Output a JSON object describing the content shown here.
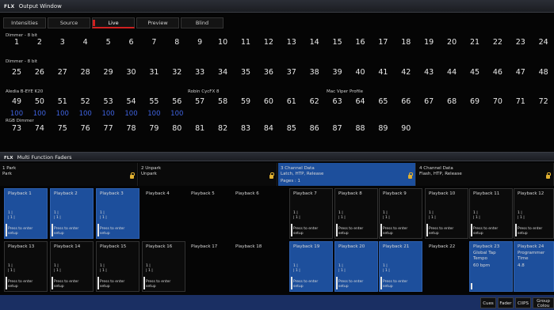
{
  "output_window": {
    "brand": "FLX",
    "title": "Output Window",
    "tabs": [
      {
        "label": "Intensities"
      },
      {
        "label": "Source"
      },
      {
        "label": "Live"
      },
      {
        "label": "Preview"
      },
      {
        "label": "Blind"
      }
    ],
    "fixture_labels": [
      "Dimmer - 8 bit",
      "Dimmer - 8 bit",
      "Aledia B-EYE K20",
      "Robin CycFX 8",
      "Mac Viper Profile",
      "RGB Dimmer"
    ],
    "rows": [
      [
        "1",
        "2",
        "3",
        "4",
        "5",
        "6",
        "7",
        "8",
        "9",
        "10",
        "11",
        "12",
        "13",
        "14",
        "15",
        "16",
        "17",
        "18",
        "19",
        "20",
        "21",
        "22",
        "23",
        "24"
      ],
      [
        "25",
        "26",
        "27",
        "28",
        "29",
        "30",
        "31",
        "32",
        "33",
        "34",
        "35",
        "36",
        "37",
        "38",
        "39",
        "40",
        "41",
        "42",
        "43",
        "44",
        "45",
        "46",
        "47",
        "48"
      ],
      [
        "49",
        "50",
        "51",
        "52",
        "53",
        "54",
        "55",
        "56",
        "57",
        "58",
        "59",
        "60",
        "61",
        "62",
        "63",
        "64",
        "65",
        "66",
        "67",
        "68",
        "69",
        "70",
        "71",
        "72"
      ],
      [
        "73",
        "74",
        "75",
        "76",
        "77",
        "78",
        "79",
        "80",
        "81",
        "82",
        "83",
        "84",
        "85",
        "86",
        "87",
        "88",
        "89",
        "90"
      ]
    ],
    "levels": [
      "100",
      "100",
      "100",
      "100",
      "100",
      "100",
      "100",
      "100"
    ]
  },
  "multi_faders": {
    "brand": "FLX",
    "title": "Multi Function Faders",
    "pages": [
      {
        "title": "1 Park",
        "sub": "Park",
        "extra": ""
      },
      {
        "title": "2 Unpark",
        "sub": "Unpark",
        "extra": ""
      },
      {
        "title": "3 Channel Data",
        "sub": "Latch, HTP, Release",
        "extra": "Pages : 1"
      },
      {
        "title": "4 Channel Data",
        "sub": "Flash, HTP, Release",
        "extra": ""
      }
    ],
    "playbacks_top": [
      {
        "name": "Playback 1",
        "info": "1 |\n| 1 |",
        "press": "Press to enter\nsetup"
      },
      {
        "name": "Playback 2",
        "info": "1 |\n| 1 |",
        "press": "Press to enter\nsetup"
      },
      {
        "name": "Playback 3",
        "info": "1 |\n| 1 |",
        "press": "Press to enter\nsetup"
      },
      {
        "name": "Playback 4",
        "info": "",
        "press": ""
      },
      {
        "name": "Playback 5",
        "info": "",
        "press": ""
      },
      {
        "name": "Playback 6",
        "info": "",
        "press": ""
      },
      {
        "name": "Playback 7",
        "info": "1 |\n| 1 |",
        "press": "Press to enter\nsetup"
      },
      {
        "name": "Playback 8",
        "info": "1 |\n| 1 |",
        "press": "Press to enter\nsetup"
      },
      {
        "name": "Playback 9",
        "info": "1 |\n| 1 |",
        "press": "Press to enter\nsetup"
      },
      {
        "name": "Playback 10",
        "info": "1 |\n| 1 |",
        "press": "Press to enter\nsetup"
      },
      {
        "name": "Playback 11",
        "info": "1 |\n| 1 |",
        "press": "Press to enter\nsetup"
      },
      {
        "name": "Playback 12",
        "info": "1 |\n| 1 |",
        "press": "Press to enter\nsetup"
      }
    ],
    "playbacks_bottom": [
      {
        "name": "Playback 13",
        "info": "1 |\n| 1 |",
        "press": "Press to enter\nsetup",
        "extra": "",
        "extra2": ""
      },
      {
        "name": "Playback 14",
        "info": "1 |\n| 1 |",
        "press": "Press to enter\nsetup",
        "extra": "",
        "extra2": ""
      },
      {
        "name": "Playback 15",
        "info": "1 |\n| 1 |",
        "press": "Press to enter\nsetup",
        "extra": "",
        "extra2": ""
      },
      {
        "name": "Playback 16",
        "info": "1 |\n| 1 |",
        "press": "Press to enter\nsetup",
        "extra": "",
        "extra2": ""
      },
      {
        "name": "Playback 17",
        "info": "",
        "press": "",
        "extra": "",
        "extra2": ""
      },
      {
        "name": "Playback 18",
        "info": "",
        "press": "",
        "extra": "",
        "extra2": ""
      },
      {
        "name": "Playback 19",
        "info": "1 |\n| 1 |",
        "press": "Press to enter\nsetup",
        "extra": "",
        "extra2": ""
      },
      {
        "name": "Playback 20",
        "info": "1 |\n| 1 |",
        "press": "Press to enter\nsetup",
        "extra": "",
        "extra2": ""
      },
      {
        "name": "Playback 21",
        "info": "1 |\n| 1 |",
        "press": "Press to enter\nsetup",
        "extra": "",
        "extra2": ""
      },
      {
        "name": "Playback 22",
        "info": "",
        "press": "",
        "extra": "",
        "extra2": ""
      },
      {
        "name": "Playback 23",
        "info": "",
        "press": "",
        "extra": "Global Tap\nTempo",
        "extra2": "60 bpm"
      },
      {
        "name": "Playback 24",
        "info": "",
        "press": "",
        "extra": "Programmer\nTime",
        "extra2": "4.8"
      }
    ]
  },
  "bottom_bar": {
    "buttons": [
      "Cues",
      "Fader",
      "CIIPS",
      "Group\nColou"
    ]
  }
}
